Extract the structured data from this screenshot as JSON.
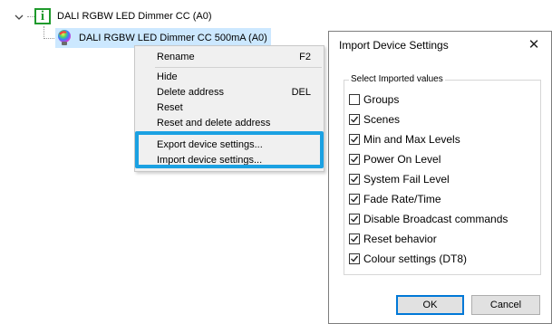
{
  "tree": {
    "root_label": "DALI RGBW LED Dimmer CC (A0)",
    "root_icon": "info-icon",
    "child_label": "DALI RGBW LED Dimmer CC 500mA (A0)",
    "child_icon": "rgb-bulb-icon",
    "info_glyph": "i"
  },
  "context_menu": {
    "items": [
      {
        "label": "Rename",
        "shortcut": "F2"
      },
      {
        "label": "Hide",
        "shortcut": ""
      },
      {
        "label": "Delete address",
        "shortcut": "DEL"
      },
      {
        "label": "Reset",
        "shortcut": ""
      },
      {
        "label": "Reset and delete address",
        "shortcut": ""
      },
      {
        "label": "Export device settings...",
        "shortcut": ""
      },
      {
        "label": "Import device settings...",
        "shortcut": ""
      }
    ],
    "highlight_color": "#1ba1e2"
  },
  "dialog": {
    "title": "Import Device Settings",
    "close_glyph": "✕",
    "group_label": "Select Imported values",
    "checkboxes": [
      {
        "label": "Groups",
        "checked": false
      },
      {
        "label": "Scenes",
        "checked": true
      },
      {
        "label": "Min and Max Levels",
        "checked": true
      },
      {
        "label": "Power On Level",
        "checked": true
      },
      {
        "label": "System Fail Level",
        "checked": true
      },
      {
        "label": "Fade Rate/Time",
        "checked": true
      },
      {
        "label": "Disable Broadcast commands",
        "checked": true
      },
      {
        "label": "Reset behavior",
        "checked": true
      },
      {
        "label": "Colour settings (DT8)",
        "checked": true
      }
    ],
    "ok_label": "OK",
    "cancel_label": "Cancel"
  }
}
